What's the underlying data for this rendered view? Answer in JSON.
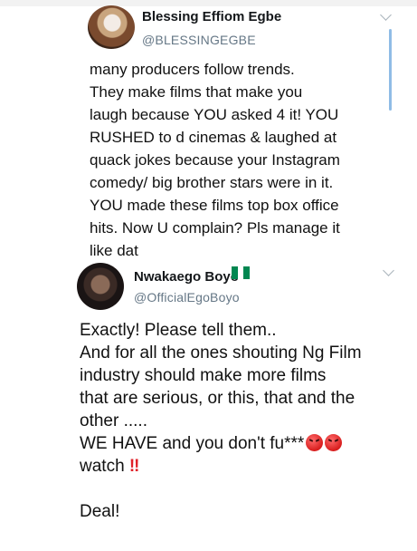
{
  "tweet1": {
    "display_name": "Blessing Effiom Egbe",
    "handle": "@BLESSINGEGBE",
    "lines": [
      "many producers follow trends.",
      "They make films that make you",
      "laugh because YOU asked 4 it! YOU",
      "RUSHED to d cinemas & laughed at",
      "quack jokes because your Instagram",
      "comedy/ big brother stars were in it.",
      "YOU made these films top box office",
      "hits. Now U complain? Pls manage it",
      "like dat"
    ]
  },
  "tweet2": {
    "display_name": "Nwakaego Boyo",
    "handle": "@OfficialEgoBoyo",
    "flag_colors": [
      "#008751",
      "#ffffff",
      "#008751"
    ],
    "lines": [
      "Exactly! Please tell them..",
      "And for all the ones shouting Ng Film",
      "industry should make more films",
      "that are serious, or this, that and the",
      "other .....",
      "WE HAVE and you don't fu***",
      "watch"
    ],
    "exclamation": "‼",
    "closing": "Deal!"
  },
  "icons": {
    "menu_chevron": "chevron-down-icon",
    "flag": "nigeria-flag-icon",
    "angry_face": "angry-face-icon"
  }
}
